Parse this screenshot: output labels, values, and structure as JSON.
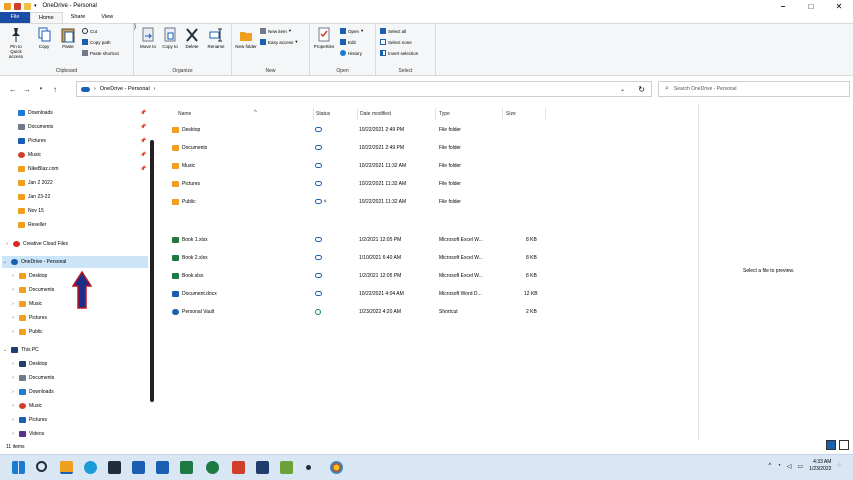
{
  "window": {
    "title": "OneDrive - Personal",
    "controls": {
      "minimize": "–",
      "maximize": "□",
      "close": "✕"
    }
  },
  "ribbon_tabs": [
    "File",
    "Home",
    "Share",
    "View"
  ],
  "ribbon": {
    "clipboard": {
      "title": "Clipboard",
      "pin": "Pin to Quick access",
      "copy": "Copy",
      "paste": "Paste",
      "cut": "Cut",
      "copy_path": "Copy path",
      "paste_shortcut": "Paste shortcut"
    },
    "organize": {
      "title": "Organize",
      "move_to": "Move to",
      "copy_to": "Copy to",
      "delete": "Delete",
      "rename": "Rename"
    },
    "new": {
      "title": "New",
      "new_folder": "New folder",
      "new_item": "New item",
      "easy_access": "Easy access"
    },
    "open": {
      "title": "Open",
      "properties": "Properties",
      "open": "Open",
      "edit": "Edit",
      "history": "History"
    },
    "select": {
      "title": "Select",
      "select_all": "Select all",
      "select_none": "Select none",
      "invert": "Invert selection"
    }
  },
  "address": {
    "path": "OneDrive - Personal",
    "separator": "›",
    "search_placeholder": "Search OneDrive - Personal"
  },
  "nav": {
    "quick_access": [
      {
        "label": "Downloads",
        "color": "#1b7bd1"
      },
      {
        "label": "Documents",
        "color": "#6f7b8b"
      },
      {
        "label": "Pictures",
        "color": "#1b5fb3"
      },
      {
        "label": "Music",
        "color": "#d13f2a"
      },
      {
        "label": "NikeBlaz.com",
        "color": "#f0a020"
      },
      {
        "label": "Jan 2 2022",
        "color": "#f0a020"
      },
      {
        "label": "Jan 23-22",
        "color": "#f0a020"
      },
      {
        "label": "Nov 15",
        "color": "#f0a020"
      },
      {
        "label": "Reseller",
        "color": "#f0a020"
      }
    ],
    "creative_cloud": "Creative Cloud Files",
    "onedrive": "OneDrive - Personal",
    "onedrive_children": [
      "Desktop",
      "Documents",
      "Music",
      "Pictures",
      "Public"
    ],
    "this_pc": "This PC",
    "this_pc_children": [
      "Desktop",
      "Documents",
      "Downloads",
      "Music",
      "Pictures",
      "Videos"
    ]
  },
  "columns": {
    "name": "Name",
    "status": "Status",
    "date": "Date modified",
    "type": "Type",
    "size": "Size"
  },
  "files": [
    {
      "name": "Desktop",
      "date": "10/22/2021 2:49 PM",
      "type": "File folder",
      "size": "",
      "icon": "folder-icon",
      "status": "cloud"
    },
    {
      "name": "Documents",
      "date": "10/22/2021 2:49 PM",
      "type": "File folder",
      "size": "",
      "icon": "folder-icon",
      "status": "cloud"
    },
    {
      "name": "Music",
      "date": "10/22/2021 11:32 AM",
      "type": "File folder",
      "size": "",
      "icon": "folder-icon",
      "status": "cloud"
    },
    {
      "name": "Pictures",
      "date": "10/22/2021 11:32 AM",
      "type": "File folder",
      "size": "",
      "icon": "folder-icon",
      "status": "cloud"
    },
    {
      "name": "Public",
      "date": "10/22/2021 11:32 AM",
      "type": "File folder",
      "size": "",
      "icon": "folder-icon",
      "status": "cloud-shared"
    },
    {
      "name": "Book 1.xlsx",
      "date": "1/2/2021 12:05 PM",
      "type": "Microsoft Excel W...",
      "size": "8 KB",
      "icon": "excel-icon",
      "status": "cloud"
    },
    {
      "name": "Book 2.xlsx",
      "date": "1/10/2021 6:40 AM",
      "type": "Microsoft Excel W...",
      "size": "8 KB",
      "icon": "excel-icon",
      "status": "cloud"
    },
    {
      "name": "Book.xlsx",
      "date": "1/2/2021 12:05 PM",
      "type": "Microsoft Excel W...",
      "size": "8 KB",
      "icon": "excel-icon",
      "status": "cloud"
    },
    {
      "name": "Document.docx",
      "date": "10/22/2021 4:04 AM",
      "type": "Microsoft Word D...",
      "size": "12 KB",
      "icon": "word-icon",
      "status": "cloud"
    },
    {
      "name": "Personal Vault",
      "date": "1/23/2022 4:20 AM",
      "type": "Shortcut",
      "size": "2 KB",
      "icon": "vault-icon",
      "status": "synced"
    }
  ],
  "preview_text": "Select a file to preview.",
  "status_bar": {
    "count": "11 items"
  },
  "taskbar": {
    "time": "4:33 AM",
    "date": "1/23/2022",
    "tray_caret": "^"
  },
  "colors": {
    "folder": "#f0a020",
    "excel": "#1d7a43",
    "word": "#1b5fb3",
    "onedrive": "#1b5fb3",
    "selection": "#cce4f7",
    "arrow": "#c0171f"
  }
}
